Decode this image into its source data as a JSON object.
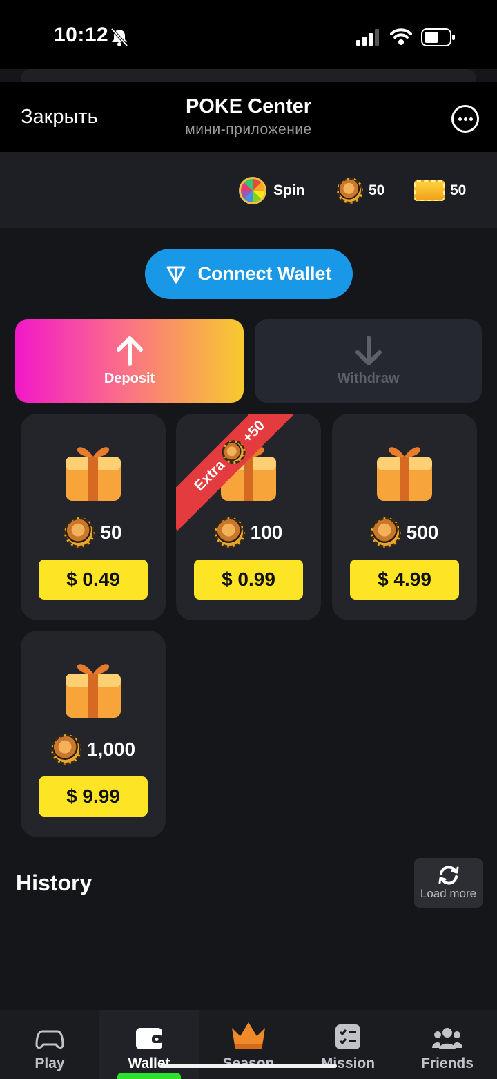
{
  "status_bar": {
    "time": "10:12"
  },
  "header": {
    "close_label": "Закрыть",
    "title": "POKE Center",
    "subtitle": "мини-приложение"
  },
  "currency": {
    "spin_label": "Spin",
    "coins": "50",
    "tickets": "50"
  },
  "wallet": {
    "connect_label": "Connect Wallet",
    "deposit_label": "Deposit",
    "withdraw_label": "Withdraw"
  },
  "packs": [
    {
      "amount": "50",
      "price": "$ 0.49"
    },
    {
      "amount": "100",
      "price": "$ 0.99",
      "ribbon_text": "Extra",
      "ribbon_bonus": "+50"
    },
    {
      "amount": "500",
      "price": "$ 4.99"
    },
    {
      "amount": "1,000",
      "price": "$ 9.99"
    }
  ],
  "history": {
    "title": "History",
    "load_more_label": "Load more"
  },
  "nav": [
    {
      "label": "Play",
      "icon": "gamepad-icon"
    },
    {
      "label": "Wallet",
      "icon": "wallet-icon"
    },
    {
      "label": "Season",
      "icon": "crown-icon"
    },
    {
      "label": "Mission",
      "icon": "checklist-icon"
    },
    {
      "label": "Friends",
      "icon": "friends-icon"
    }
  ],
  "colors": {
    "accent_blue": "#1a98e8",
    "price_yellow": "#fde424",
    "ribbon_red": "#e43b3f",
    "active_indicator": "#2ee12e"
  }
}
